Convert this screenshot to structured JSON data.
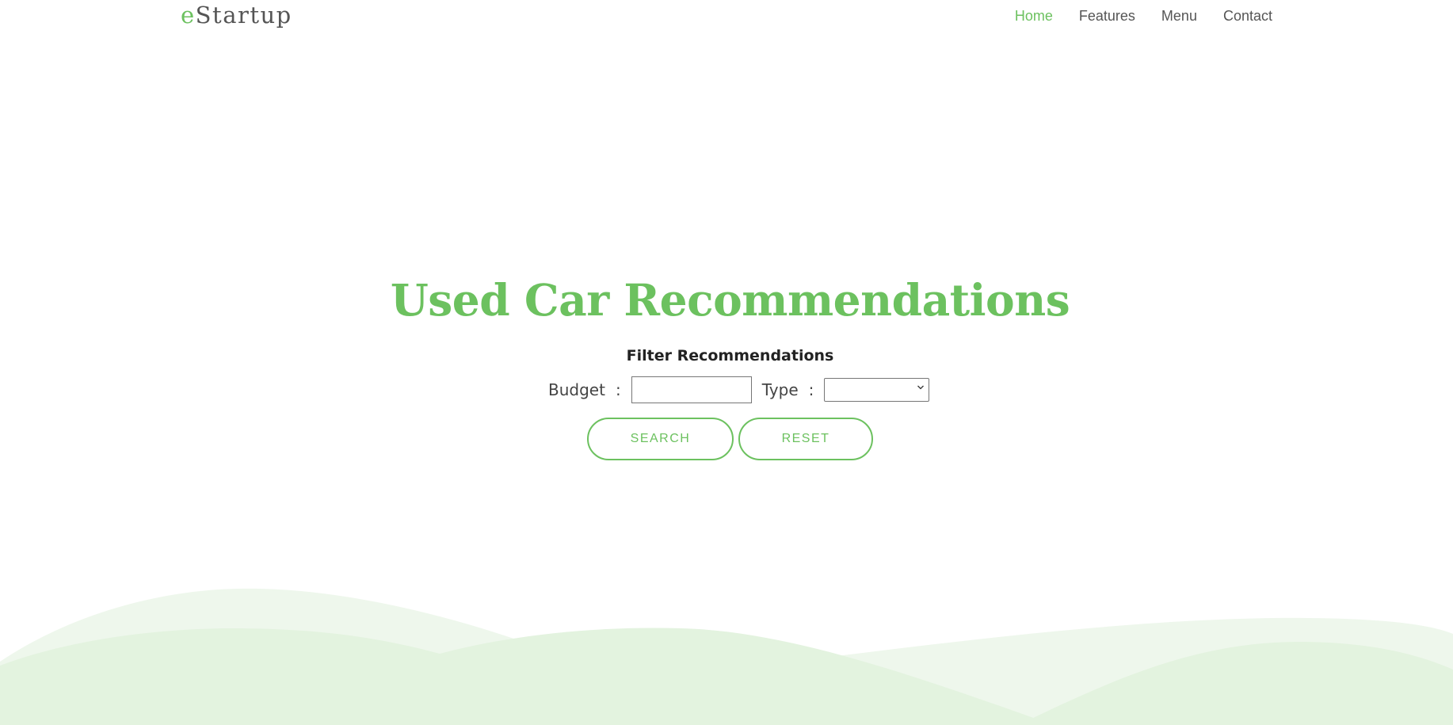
{
  "brand": {
    "logo_first_letter": "e",
    "logo_rest": "Startup",
    "accent_color": "#6cc15f"
  },
  "nav": {
    "items": [
      {
        "label": "Home",
        "active": true
      },
      {
        "label": "Features",
        "active": false
      },
      {
        "label": "Menu",
        "active": false
      },
      {
        "label": "Contact",
        "active": false
      }
    ]
  },
  "hero": {
    "title": "Used Car Recommendations",
    "filter_heading": "Filter Recommendations"
  },
  "filters": {
    "budget_label": "Budget",
    "budget_value": "",
    "type_label": "Type",
    "type_selected": "",
    "separator": ":"
  },
  "buttons": {
    "search_label": "SEARCH",
    "reset_label": "RESET"
  },
  "icons": {
    "select_arrow": "chevron-down-icon"
  },
  "decor": {
    "wave_light_color": "#eef7ec",
    "wave_mid_color": "#e3f3df"
  }
}
